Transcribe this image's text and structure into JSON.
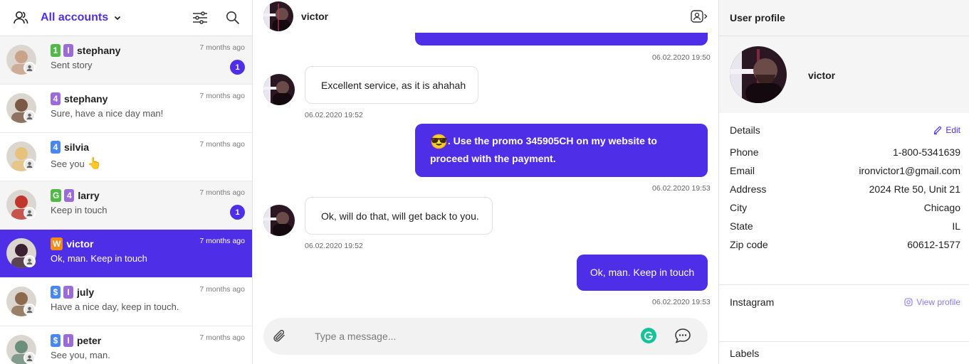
{
  "sidebar": {
    "title": "All accounts",
    "conversations": [
      {
        "tags": [
          {
            "text": "1",
            "color": "green"
          },
          {
            "text": "I",
            "color": "purple"
          }
        ],
        "name": "stephany",
        "time": "7 months ago",
        "preview": "Sent story",
        "unread": "1",
        "bg": "grey",
        "avatar": "#c9a38a"
      },
      {
        "tags": [
          {
            "text": "4",
            "color": "purple"
          }
        ],
        "name": "stephany",
        "time": "7 months ago",
        "preview": "Sure, have a nice day man!",
        "unread": "",
        "bg": "white",
        "avatar": "#7a5a45"
      },
      {
        "tags": [
          {
            "text": "4",
            "color": "blue"
          }
        ],
        "name": "silvia",
        "time": "7 months ago",
        "preview": "See you",
        "preview_emoji": "👆",
        "unread": "",
        "bg": "white",
        "avatar": "#e7c27a"
      },
      {
        "tags": [
          {
            "text": "G",
            "color": "green"
          },
          {
            "text": "4",
            "color": "purple"
          }
        ],
        "name": "larry",
        "time": "7 months ago",
        "preview": "Keep in touch",
        "unread": "1",
        "bg": "grey",
        "avatar": "#c0352c"
      },
      {
        "tags": [
          {
            "text": "W",
            "color": "orange"
          }
        ],
        "name": "victor",
        "time": "7 months ago",
        "preview": "Ok, man. Keep in touch",
        "unread": "",
        "bg": "active",
        "avatar": "#3a2030"
      },
      {
        "tags": [
          {
            "text": "$",
            "color": "blue"
          },
          {
            "text": "I",
            "color": "purple"
          }
        ],
        "name": "july",
        "time": "7 months ago",
        "preview": "Have a nice day, keep in touch.",
        "unread": "",
        "bg": "white",
        "avatar": "#8b6a4e"
      },
      {
        "tags": [
          {
            "text": "$",
            "color": "blue"
          },
          {
            "text": "I",
            "color": "purple"
          }
        ],
        "name": "peter",
        "time": "7 months ago",
        "preview": "See you, man.",
        "unread": "",
        "bg": "white",
        "avatar": "#6b8f7a"
      }
    ]
  },
  "chat": {
    "contact_name": "victor",
    "messages": {
      "ts1": "06.02.2020 19:50",
      "in1": "Excellent service, as it is ahahah",
      "ts2": "06.02.2020 19:52",
      "out2_emoji": "😎",
      "out2": ". Use the promo 345905CH on my website to proceed with the payment.",
      "ts3": "06.02.2020 19:53",
      "in2": "Ok, will do that, will get back to you.",
      "ts4": "06.02.2020 19:52",
      "out3": "Ok, man. Keep in touch",
      "ts5": "06.02.2020 19:53"
    },
    "composer_placeholder": "Type a message..."
  },
  "profile": {
    "title": "User profile",
    "name": "victor",
    "details_label": "Details",
    "edit_label": "Edit",
    "fields": [
      {
        "k": "Phone",
        "v": "1-800-5341639"
      },
      {
        "k": "Email",
        "v": "ironvictor1@gmail.com"
      },
      {
        "k": "Address",
        "v": "2024 Rte 50, Unit 21"
      },
      {
        "k": "City",
        "v": "Chicago"
      },
      {
        "k": "State",
        "v": "IL"
      },
      {
        "k": "Zip code",
        "v": "60612-1577"
      }
    ],
    "instagram_label": "Instagram",
    "view_profile": "View profile",
    "labels_label": "Labels"
  },
  "colors": {
    "accent": "#4f2ee8",
    "green": "#52b848",
    "purple": "#9b6bd8",
    "blue": "#4a86f0",
    "orange": "#f28b16"
  }
}
